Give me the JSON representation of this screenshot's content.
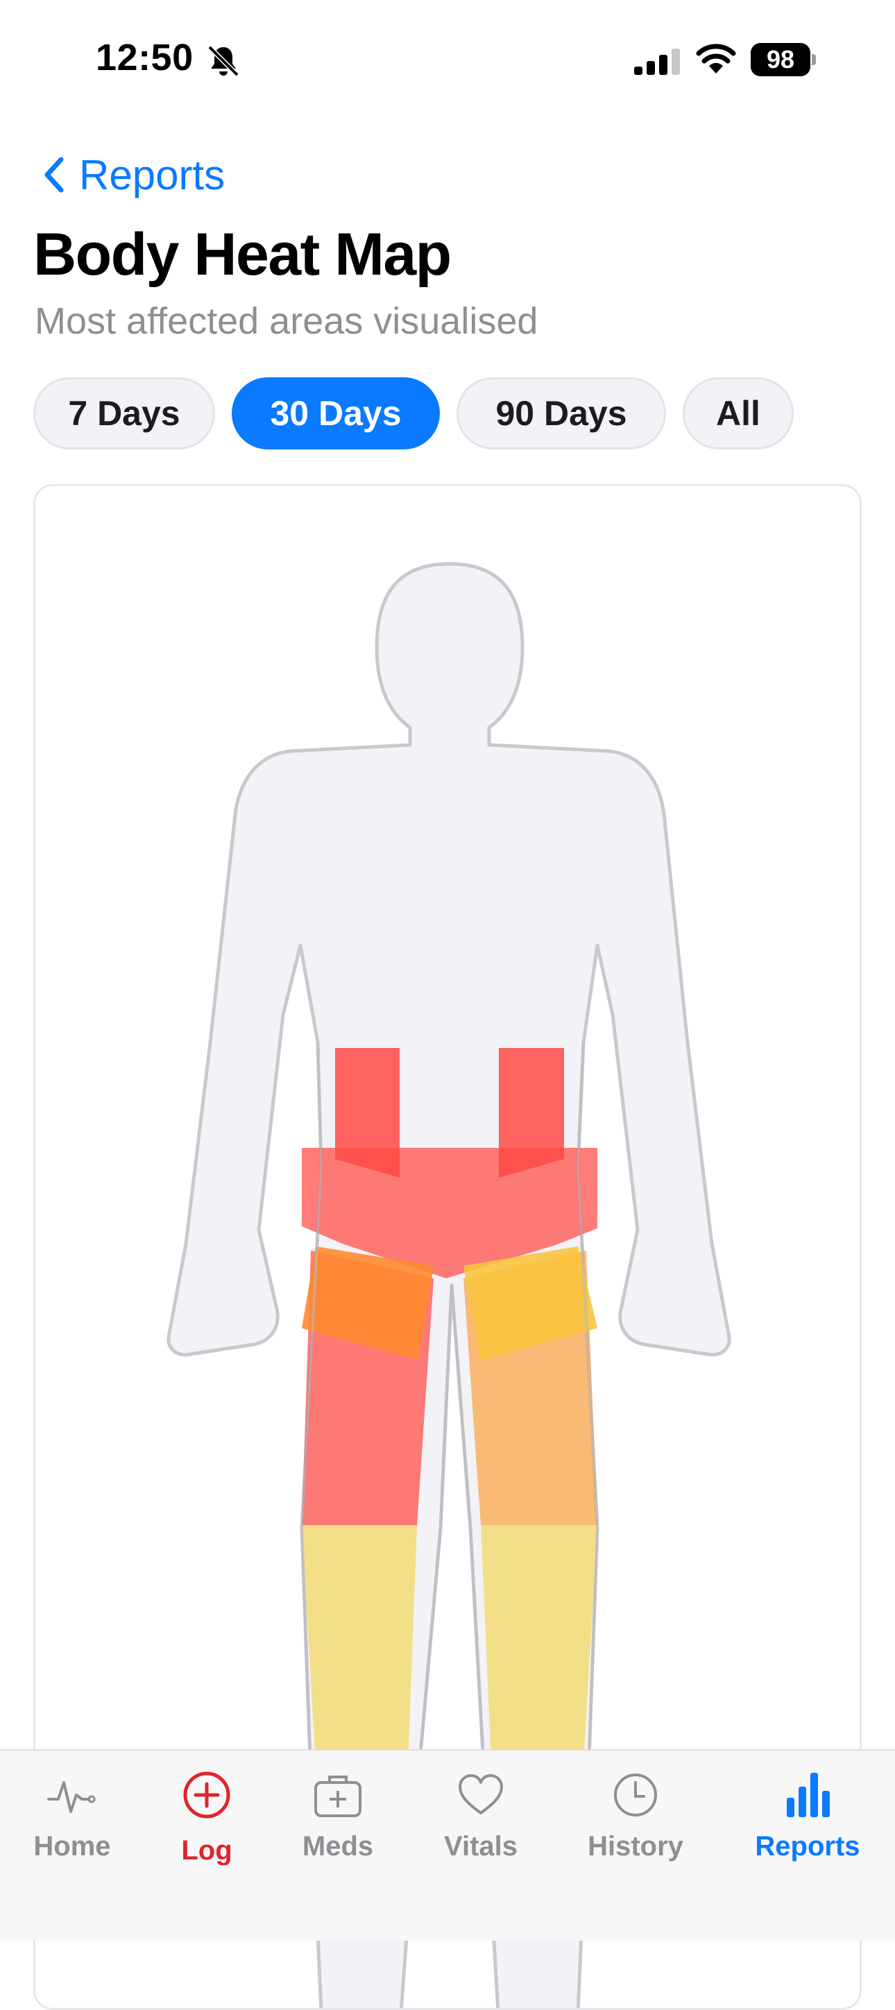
{
  "status_bar": {
    "time": "12:50",
    "battery": "98"
  },
  "nav": {
    "back_label": "Reports"
  },
  "header": {
    "title": "Body Heat Map",
    "subtitle": "Most affected areas visualised"
  },
  "filters": [
    {
      "label": "7 Days",
      "active": false
    },
    {
      "label": "30 Days",
      "active": true
    },
    {
      "label": "90 Days",
      "active": false
    },
    {
      "label": "All",
      "active": false
    }
  ],
  "heat_colors": {
    "high": "#ff4a44",
    "medium": "#f9a343",
    "low": "#f4dc76",
    "body": "#f2f2f7"
  },
  "tabs": [
    {
      "label": "Home",
      "icon": "heartbeat-icon"
    },
    {
      "label": "Log",
      "icon": "plus-circle-icon"
    },
    {
      "label": "Meds",
      "icon": "medkit-icon"
    },
    {
      "label": "Vitals",
      "icon": "heart-icon"
    },
    {
      "label": "History",
      "icon": "clock-icon"
    },
    {
      "label": "Reports",
      "icon": "bar-chart-icon",
      "selected": true
    }
  ]
}
